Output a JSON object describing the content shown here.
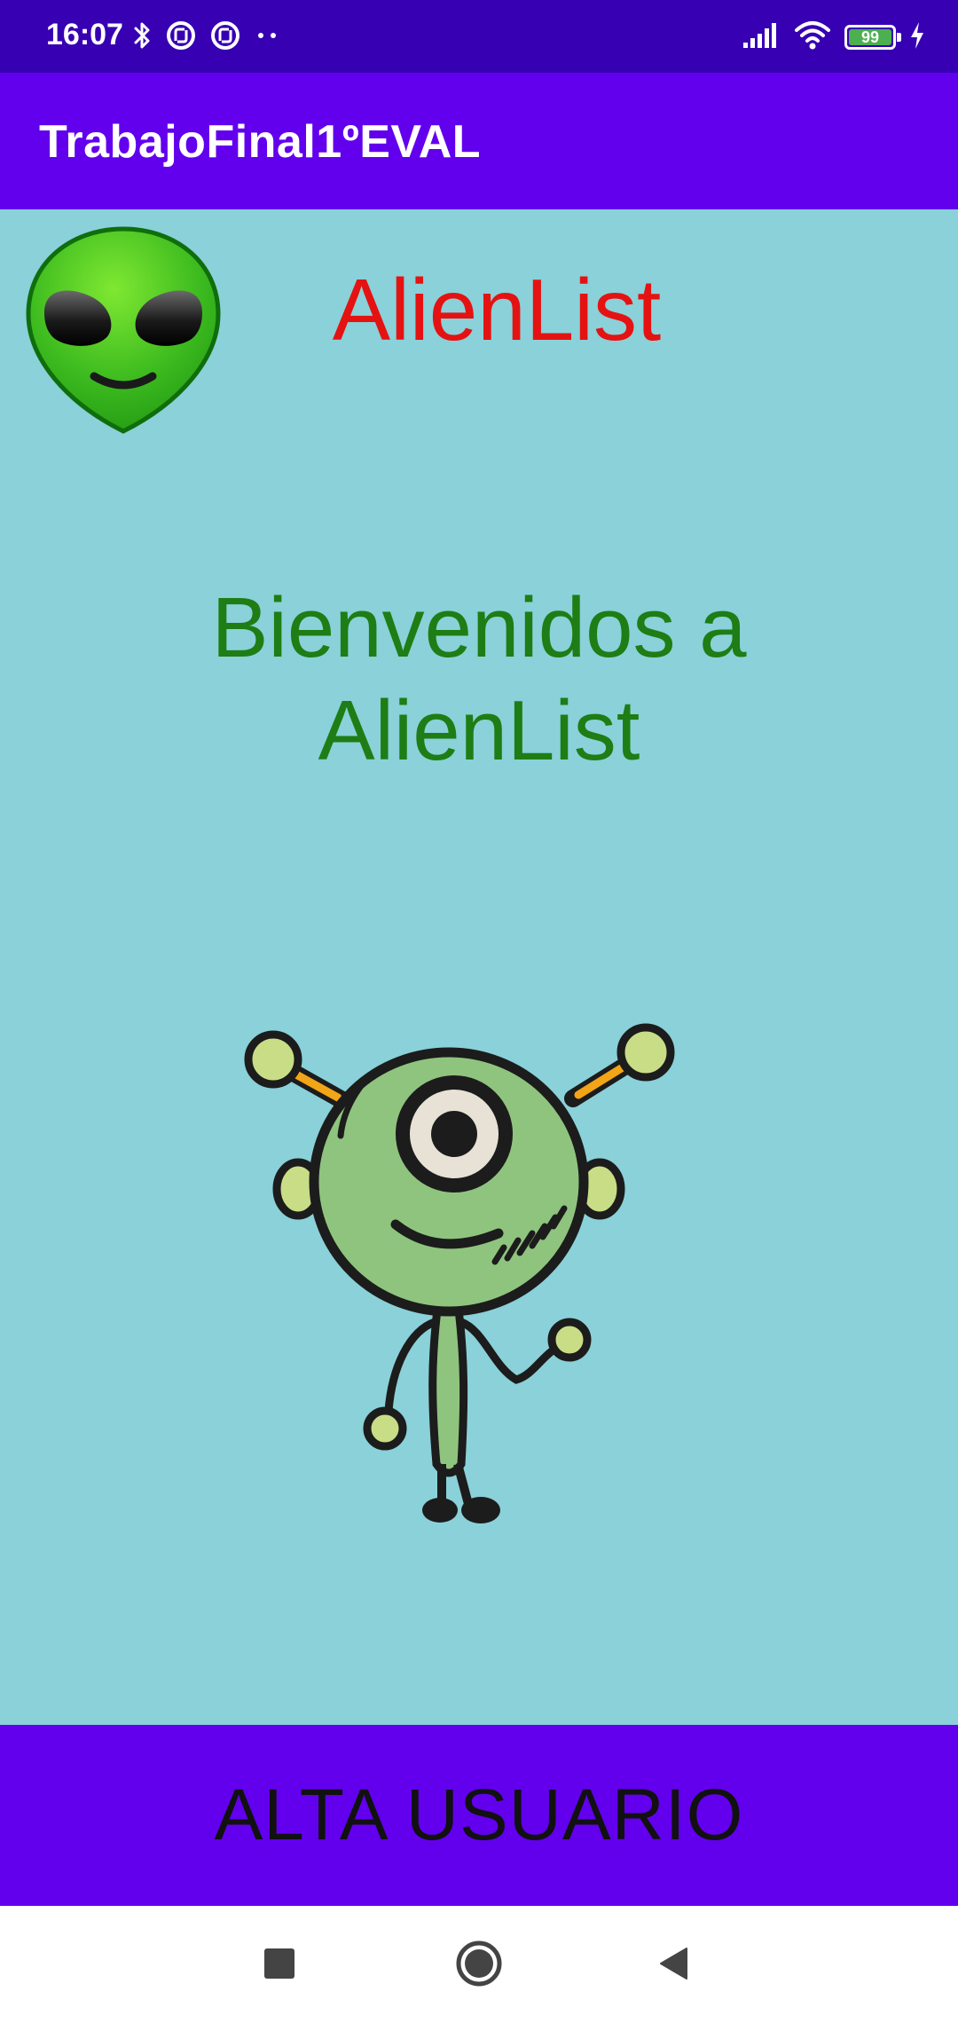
{
  "status_bar": {
    "time": "16:07",
    "battery_level": "99",
    "battery_fraction": 0.99,
    "left_icons": [
      "bluetooth-icon",
      "nfc-icon",
      "nfc-icon",
      "more-dots-icon"
    ],
    "right_icons": [
      "signal-icon",
      "wifi-icon",
      "battery-icon",
      "charging-icon"
    ]
  },
  "app_bar": {
    "title": "TrabajoFinal1ºEVAL"
  },
  "main": {
    "header_title": "AlienList",
    "welcome_text": "Bienvenidos a AlienList",
    "header_icon": "alien-head-icon",
    "illustration": "alien-character"
  },
  "buttons": {
    "alta_usuario": "ALTA USUARIO"
  },
  "nav_bar": {
    "items": [
      "recents-square",
      "home-circle",
      "back-triangle"
    ]
  },
  "colors": {
    "status_bar": "#3700b3",
    "app_bar": "#6200ee",
    "background": "#8ad1d9",
    "header_title": "#e51212",
    "welcome_text": "#1e7d14",
    "button": "#6200ee",
    "button_text": "#111111"
  }
}
